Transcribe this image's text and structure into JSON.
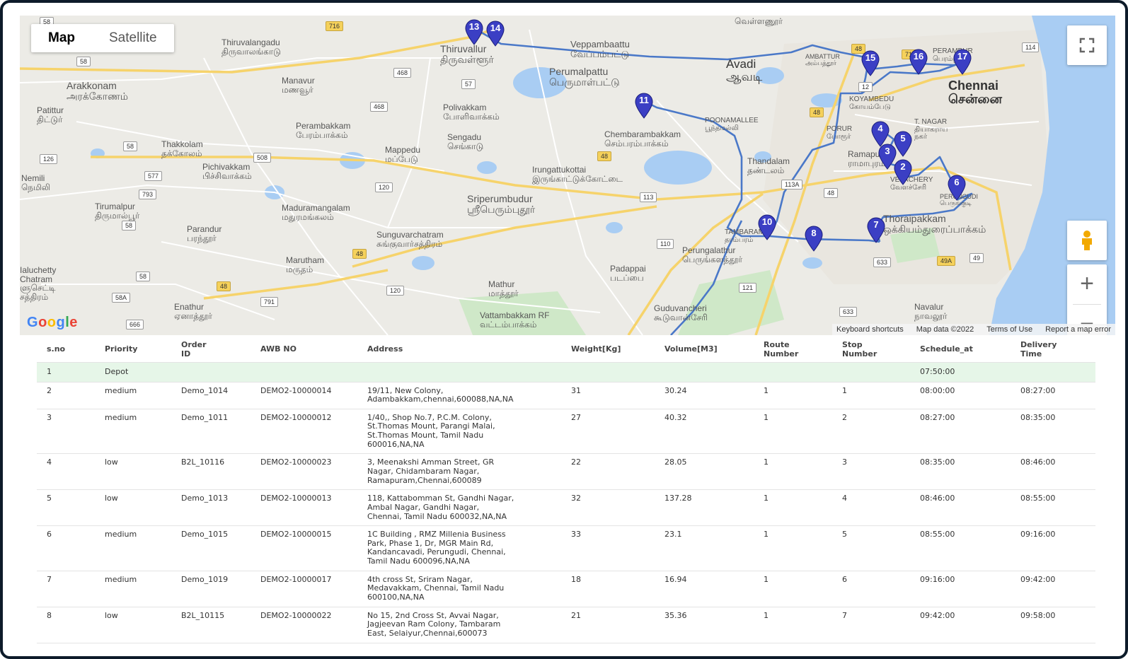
{
  "map": {
    "type_buttons": [
      "Map",
      "Satellite"
    ],
    "active_type": "Map",
    "controls": {
      "zoom_in": "+",
      "zoom_out": "−"
    },
    "logo": "Google",
    "attribution": [
      "Keyboard shortcuts",
      "Map data ©2022",
      "Terms of Use",
      "Report a map error"
    ],
    "places": {
      "thiruvallur": [
        "Thiruvallur",
        "திருவள்ளூர்"
      ],
      "thiruvalangadu": [
        "Thiruvalangadu",
        "திருவாலங்காடு"
      ],
      "veppambattu": [
        "Veppambaattu",
        "வேப்பம்பட்டு"
      ],
      "avadi": [
        "Avadi",
        "ஆவடி"
      ],
      "perumalpattu": [
        "Perumalpattu",
        "பெருமாள்பட்டு"
      ],
      "arakkonam": [
        "Arakkonam",
        "அரக்கோணம்"
      ],
      "manavur": [
        "Manavur",
        "மணவூர்"
      ],
      "pattur": [
        "Patittur",
        "திட்டுர்"
      ],
      "polivakkam": [
        "Polivakkam",
        "போளிவாக்கம்"
      ],
      "perambakkam": [
        "Perambakkam",
        "பேரம்பாக்கம்"
      ],
      "sengadu": [
        "Sengadu",
        "செங்காடு"
      ],
      "thakkolam": [
        "Thakkolam",
        "தக்கோலம்"
      ],
      "mappedu": [
        "Mappedu",
        "மப்பேடு"
      ],
      "pichivakkam": [
        "Pichivakkam",
        "பிச்சிவாக்கம்"
      ],
      "nemili": [
        "Nemili",
        "நெமிலி"
      ],
      "chembarambakkam": [
        "Chembarambakkam",
        "செம்பரம்பாக்கம்"
      ],
      "irungattukottai": [
        "Irungattukottai",
        "இருங்காட்டுக்கோட்டை"
      ],
      "sriperumbudur": [
        "Sriperumbudur",
        "ஸ்ரீபெரும்புதூர்"
      ],
      "tirumalpur": [
        "Tirumalpur",
        "திருமால்பூர்"
      ],
      "maduramangalam": [
        "Maduramangalam",
        "மதுரமங்கலம்"
      ],
      "parandur": [
        "Parandur",
        "பரந்தூர்"
      ],
      "sunguvarchatram": [
        "Sunguvarchatram",
        "சுங்குவார்சத்திரம்"
      ],
      "marutham": [
        "Marutham",
        "மருதம்"
      ],
      "kaluchetty": [
        "Ialuchetty",
        "Chatram",
        "ளுசெட்டி",
        "சத்திரம்"
      ],
      "padappai": [
        "Padappai",
        "படப்பை"
      ],
      "mathur": [
        "Mathur",
        "மாத்தூர்"
      ],
      "enathur": [
        "Enathur",
        "ஏனாத்தூர்"
      ],
      "vattambakkam": [
        "Vattambakkam RF",
        "வட்டம்பாக்கம்"
      ],
      "guduvancheri": [
        "Guduvancheri",
        "கூடுவான்சேரி"
      ],
      "perungalathur": [
        "Perungalathur",
        "பெருங்களத்தூர்"
      ],
      "thandalam": [
        "Thandalam",
        "தண்டலம்"
      ],
      "tambaram": [
        "TAMBARAM",
        "தாம்பரம்"
      ],
      "chennai": [
        "Chennai",
        "சென்னை"
      ],
      "koyambedu": [
        "KOYAMBEDU",
        "கோயம்பேடு"
      ],
      "tnagar": [
        "T. NAGAR",
        "தியாகராய",
        "நகர்"
      ],
      "poonamallee": [
        "POONAMALLEE",
        "பூந்தமல்லி"
      ],
      "porur": [
        "PORUR",
        "போரூர்"
      ],
      "ramapuram": [
        "Ramapuram",
        "ராமாபுரம்"
      ],
      "velachery": [
        "VELACHERY",
        "வேளச்சேரி"
      ],
      "perungudi": [
        "PERUNGUDI",
        "பெருங்குடி"
      ],
      "thoraipakkam": [
        "Thoraipakkam",
        "ஒக்கியம்துரைப்பாக்கம்"
      ],
      "navalur": [
        "Navalur",
        "நாவலூர்"
      ],
      "ambattur": [
        "AMBATTUR",
        "அம்பத்தூர்"
      ],
      "perambur": [
        "PERAMBUR",
        "பெரம்பூர்"
      ],
      "vellanur": [
        "வெள்ளணூர்"
      ]
    },
    "road_shields": [
      "58",
      "716",
      "468",
      "57",
      "468",
      "58",
      "126",
      "577",
      "793",
      "58",
      "120",
      "508",
      "48",
      "113",
      "110",
      "48",
      "48",
      "12",
      "113A",
      "48",
      "633",
      "49A",
      "49",
      "58",
      "48",
      "58A",
      "791",
      "120",
      "121",
      "633",
      "666",
      "114",
      "48",
      "716"
    ],
    "markers": [
      "13",
      "14",
      "11",
      "15",
      "16",
      "17",
      "4",
      "5",
      "3",
      "2",
      "6",
      "10",
      "8",
      "7"
    ]
  },
  "table": {
    "headers": {
      "sno": "s.no",
      "priority": "Priority",
      "order_id": [
        "Order",
        "ID"
      ],
      "awb": "AWB NO",
      "address": "Address",
      "weight": "Weight[Kg]",
      "volume": "Volume[M3]",
      "route": [
        "Route",
        "Number"
      ],
      "stop": [
        "Stop",
        "Number"
      ],
      "schedule": "Schedule_at",
      "delivery": [
        "Delivery",
        "Time"
      ]
    },
    "depot": {
      "sno": "1",
      "priority": "Depot",
      "schedule": "07:50:00"
    },
    "rows": [
      {
        "sno": "2",
        "priority": "medium",
        "order_id": "Demo_1014",
        "awb": "DEMO2-10000014",
        "address": [
          "19/11, New Colony,",
          "Adambakkam,chennai,600088,NA,NA"
        ],
        "weight": "31",
        "volume": "30.24",
        "route": "1",
        "stop": "1",
        "schedule": "08:00:00",
        "delivery": "08:27:00"
      },
      {
        "sno": "3",
        "priority": "medium",
        "order_id": "Demo_1011",
        "awb": "DEMO2-10000012",
        "address": [
          "1/40,, Shop No.7, P.C.M. Colony,",
          "St.Thomas Mount, Parangi Malai,",
          "St.Thomas Mount, Tamil Nadu",
          "600016,NA,NA"
        ],
        "weight": "27",
        "volume": "40.32",
        "route": "1",
        "stop": "2",
        "schedule": "08:27:00",
        "delivery": "08:35:00"
      },
      {
        "sno": "4",
        "priority": "low",
        "order_id": "B2L_10116",
        "awb": "DEMO2-10000023",
        "address": [
          "3, Meenakshi Amman Street, GR",
          "Nagar, Chidambaram Nagar,",
          "Ramapuram,Chennai,600089"
        ],
        "weight": "22",
        "volume": "28.05",
        "route": "1",
        "stop": "3",
        "schedule": "08:35:00",
        "delivery": "08:46:00"
      },
      {
        "sno": "5",
        "priority": "low",
        "order_id": "Demo_1013",
        "awb": "DEMO2-10000013",
        "address": [
          "118, Kattabomman St, Gandhi Nagar,",
          "Ambal Nagar, Gandhi Nagar,",
          "Chennai, Tamil Nadu 600032,NA,NA"
        ],
        "weight": "32",
        "volume": "137.28",
        "route": "1",
        "stop": "4",
        "schedule": "08:46:00",
        "delivery": "08:55:00"
      },
      {
        "sno": "6",
        "priority": "medium",
        "order_id": "Demo_1015",
        "awb": "DEMO2-10000015",
        "address": [
          "1C Building , RMZ Millenia Business",
          "Park, Phase 1, Dr, MGR Main Rd,",
          "Kandancavadi, Perungudi, Chennai,",
          "Tamil Nadu 600096,NA,NA"
        ],
        "weight": "33",
        "volume": "23.1",
        "route": "1",
        "stop": "5",
        "schedule": "08:55:00",
        "delivery": "09:16:00"
      },
      {
        "sno": "7",
        "priority": "medium",
        "order_id": "Demo_1019",
        "awb": "DEMO2-10000017",
        "address": [
          "4th cross St, Sriram Nagar,",
          "Medavakkam, Chennai, Tamil Nadu",
          "600100,NA,NA"
        ],
        "weight": "18",
        "volume": "16.94",
        "route": "1",
        "stop": "6",
        "schedule": "09:16:00",
        "delivery": "09:42:00"
      },
      {
        "sno": "8",
        "priority": "low",
        "order_id": "B2L_10115",
        "awb": "DEMO2-10000022",
        "address": [
          "No 15, 2nd Cross St, Avvai Nagar,",
          "Jagjeevan Ram Colony, Tambaram",
          "East, Selaiyur,Chennai,600073"
        ],
        "weight": "21",
        "volume": "35.36",
        "route": "1",
        "stop": "7",
        "schedule": "09:42:00",
        "delivery": "09:58:00"
      }
    ]
  },
  "colors": {
    "route": "#4a78c8",
    "marker": "#3b3fc4",
    "depot_row": "#e6f6e8",
    "water": "#a9cdf3",
    "park": "#cfe8c8",
    "highway": "#f6d36b"
  }
}
